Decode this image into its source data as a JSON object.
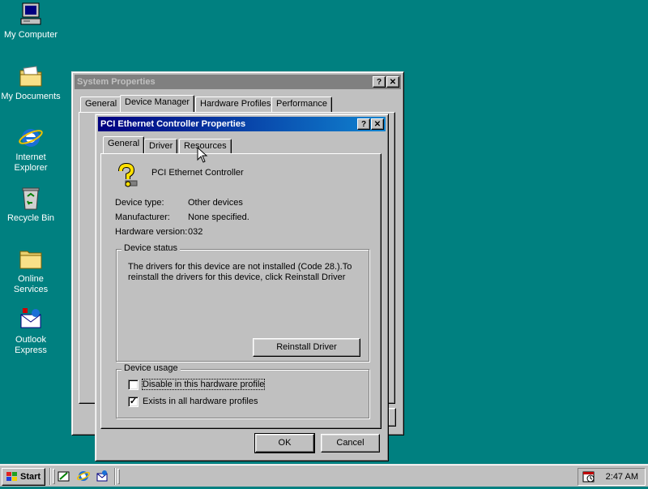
{
  "desktop": {
    "icons": [
      {
        "label": "My Computer",
        "icon": "computer-icon"
      },
      {
        "label": "My Documents",
        "icon": "folder-documents-icon"
      },
      {
        "label": "Internet Explorer",
        "icon": "ie-icon"
      },
      {
        "label": "Recycle Bin",
        "icon": "recycle-bin-icon"
      },
      {
        "label": "Online Services",
        "icon": "folder-icon"
      },
      {
        "label": "Outlook Express",
        "icon": "outlook-icon"
      }
    ]
  },
  "system_properties": {
    "title": "System Properties",
    "tabs": [
      "General",
      "Device Manager",
      "Hardware Profiles",
      "Performance"
    ],
    "selected_tab": "Device Manager"
  },
  "device_dialog": {
    "title": "PCI Ethernet Controller Properties",
    "tabs": [
      "General",
      "Driver",
      "Resources"
    ],
    "selected_tab": "General",
    "device_name": "PCI Ethernet Controller",
    "fields": {
      "device_type_label": "Device type:",
      "device_type_value": "Other devices",
      "manufacturer_label": "Manufacturer:",
      "manufacturer_value": "None specified.",
      "hardware_version_label": "Hardware version:",
      "hardware_version_value": "032"
    },
    "status": {
      "group_title": "Device status",
      "line1": "The drivers for this device are not installed  (Code 28.).To",
      "line2": "reinstall the drivers for this device, click Reinstall Driver",
      "reinstall_button": "Reinstall Driver"
    },
    "usage": {
      "group_title": "Device usage",
      "disable_label": "Disable in this hardware profile",
      "disable_checked": false,
      "exists_label": "Exists in all hardware profiles",
      "exists_checked": true
    },
    "ok_button": "OK",
    "cancel_button": "Cancel",
    "help_button": "?",
    "close_button": "✕"
  },
  "taskbar": {
    "start_label": "Start",
    "clock": "2:47 AM"
  },
  "colors": {
    "desktop": "#008080",
    "active_title": "#000080",
    "inactive_title": "#808080",
    "face": "#c0c0c0"
  }
}
